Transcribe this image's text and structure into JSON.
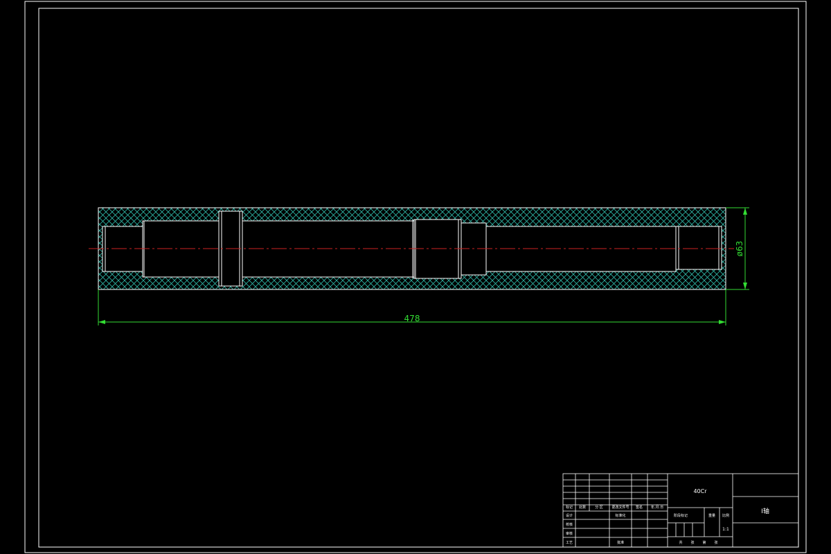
{
  "drawing": {
    "dimensions": {
      "length": "478",
      "diameter": "ø63"
    },
    "title_block": {
      "material": "40Cr",
      "part_name": "I轴",
      "scale": "1:1",
      "row_labels": [
        "标记",
        "设计",
        "校核",
        "审核",
        "工艺"
      ],
      "head_row": [
        "标记",
        "处数",
        "分 区",
        "更改文件号",
        "签名",
        "年.月.日"
      ],
      "std_label": "标准化",
      "approve_label": "批准",
      "stage_mark": "阶段标记",
      "weight_label": "重量",
      "scale_label": "比例",
      "sheet_footer": [
        "共",
        "张",
        "第",
        "张"
      ]
    },
    "colors": {
      "background": "#000000",
      "lines": "#ffffff",
      "hatch": "#2fb8a8",
      "centerline": "#cc2222",
      "dimension": "#33dd33"
    }
  }
}
